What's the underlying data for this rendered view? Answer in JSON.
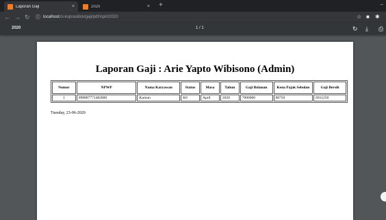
{
  "browser": {
    "tabs": [
      {
        "title": "Laporan Gaji",
        "active": true
      },
      {
        "title": "2020",
        "active": false
      }
    ],
    "new_tab": "+",
    "close": "×",
    "url_host": "localhost",
    "url_path": "/ci-koprasitick/gaji/pdf/April/2020"
  },
  "pdf": {
    "filename": "2020",
    "page_counter": "1 / 1"
  },
  "report": {
    "title": "Laporan Gaji : Arie Yapto Wibisono (Admin)",
    "headers": [
      "Nomor",
      "NPWP",
      "Nama Karyawan",
      "Status",
      "Masa",
      "Tahun",
      "Gaji Bulanan",
      "Kena Pajak Sebulan",
      "Gaji Bersih"
    ],
    "rows": [
      [
        "1",
        "898887771482800",
        "Karnun",
        "K0",
        "April",
        "2020",
        "7000000",
        "88750",
        "6911250"
      ]
    ],
    "date": "Tuesday, 23-06-2020"
  },
  "colors": {
    "tabbar": "#202124",
    "toolbar": "#35363a",
    "pdf_toolbar": "#323639",
    "viewer_bg": "#525659",
    "favicon": "#f47b20"
  }
}
